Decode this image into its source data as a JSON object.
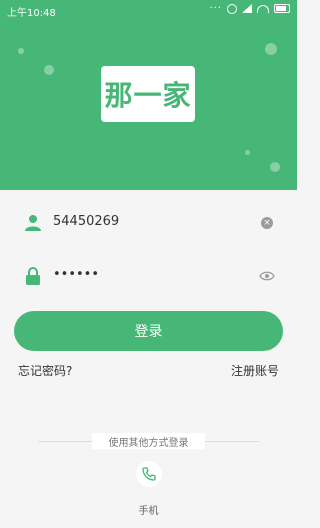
{
  "status_bar": {
    "time": "上午10:48",
    "icons": [
      "dots-icon",
      "alarm-icon",
      "signal-icon",
      "wifi-icon",
      "battery-icon"
    ]
  },
  "logo": {
    "text": "那一家"
  },
  "form": {
    "username": {
      "value": "54450269",
      "icon": "user-icon",
      "action_icon": "clear-icon"
    },
    "password": {
      "value": "••••••",
      "icon": "lock-icon",
      "action_icon": "eye-icon"
    }
  },
  "actions": {
    "login_label": "登录",
    "forgot_password": "忘记密码?",
    "register": "注册账号"
  },
  "other_login": {
    "divider_text": "使用其他方式登录",
    "phone_label": "手机"
  },
  "colors": {
    "accent": "#47b777",
    "background": "#f5f5f5"
  }
}
